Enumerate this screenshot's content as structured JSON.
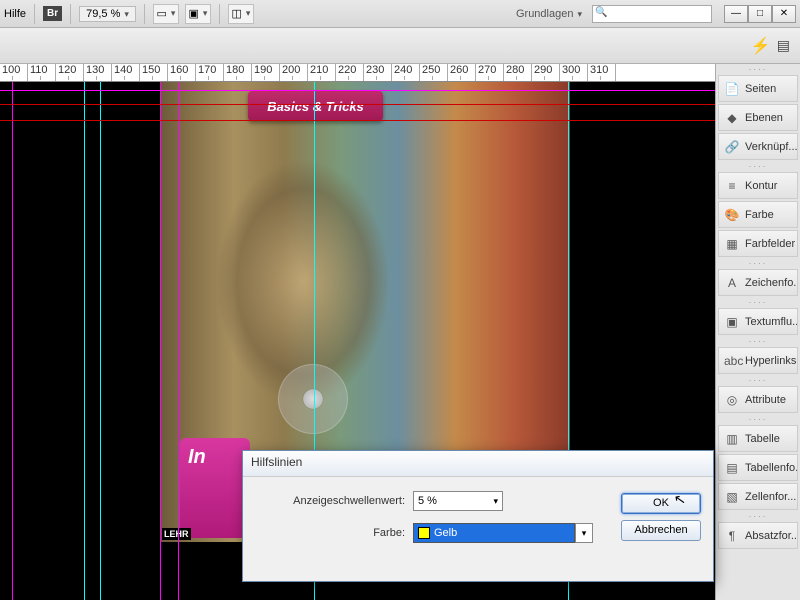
{
  "topbar": {
    "help": "Hilfe",
    "br": "Br",
    "zoom": "79,5 %",
    "layout_label": "Grundlagen",
    "search_placeholder": ""
  },
  "ruler": [
    "100",
    "110",
    "120",
    "130",
    "140",
    "150",
    "160",
    "170",
    "180",
    "190",
    "200",
    "210",
    "220",
    "230",
    "240",
    "250",
    "260",
    "270",
    "280",
    "290",
    "300",
    "310"
  ],
  "canvas": {
    "badge": "Basics & Tricks",
    "bottom_badge": "In",
    "lehr": "LEHR"
  },
  "panels": [
    {
      "icon": "📄",
      "label": "Seiten",
      "name": "panel-seiten"
    },
    {
      "icon": "◆",
      "label": "Ebenen",
      "name": "panel-ebenen"
    },
    {
      "icon": "🔗",
      "label": "Verknüpf...",
      "name": "panel-verknuepfungen"
    },
    {
      "gap": true
    },
    {
      "icon": "≡",
      "label": "Kontur",
      "name": "panel-kontur"
    },
    {
      "icon": "🎨",
      "label": "Farbe",
      "name": "panel-farbe"
    },
    {
      "icon": "▦",
      "label": "Farbfelder",
      "name": "panel-farbfelder"
    },
    {
      "gap": true
    },
    {
      "icon": "A",
      "label": "Zeichenfo...",
      "name": "panel-zeichenformate"
    },
    {
      "gap": true
    },
    {
      "icon": "▣",
      "label": "Textumflu...",
      "name": "panel-textumfluss"
    },
    {
      "gap": true
    },
    {
      "icon": "abc",
      "label": "Hyperlinks",
      "name": "panel-hyperlinks"
    },
    {
      "gap": true
    },
    {
      "icon": "◎",
      "label": "Attribute",
      "name": "panel-attribute"
    },
    {
      "gap": true
    },
    {
      "icon": "▥",
      "label": "Tabelle",
      "name": "panel-tabelle"
    },
    {
      "icon": "▤",
      "label": "Tabellenfo...",
      "name": "panel-tabellenformate"
    },
    {
      "icon": "▧",
      "label": "Zellenfor...",
      "name": "panel-zellenformate"
    },
    {
      "gap": true
    },
    {
      "icon": "¶",
      "label": "Absatzfor...",
      "name": "panel-absatzformate"
    }
  ],
  "dialog": {
    "title": "Hilfslinien",
    "threshold_label": "Anzeigeschwellenwert:",
    "threshold_value": "5 %",
    "color_label": "Farbe:",
    "color_value": "Gelb",
    "ok": "OK",
    "cancel": "Abbrechen"
  }
}
